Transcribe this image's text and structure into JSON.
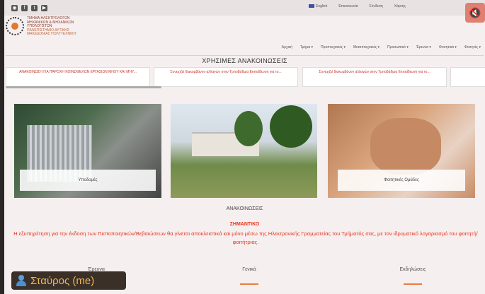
{
  "topbar": {
    "social_icons": [
      "rss-icon",
      "facebook-icon",
      "twitter-icon",
      "youtube-icon"
    ],
    "links": [
      "English",
      "Επικοινωνία",
      "Σύνδεση",
      "Χάρτης"
    ]
  },
  "header": {
    "logo_text_line1": "ΤΜΗΜΑ ΗΛΕΚΤΡΟΛΟΓΩΝ ΜΗΧΑΝΙΚΩΝ & ΜΗΧΑΝΙΚΩΝ ΥΠΟΛΟΓΙΣΤΩΝ",
    "logo_text_line2": "ΠΑΝΕΠΙΣΤΗΜΙΟ ΔΥΤΙΚΗΣ ΜΑΚΕΔΟΝΙΑΣ ΠΟΛΥΤΕΧΝΙΚΗ"
  },
  "nav": [
    "Αρχική",
    "Τμήμα ▾",
    "Προπτυχιακές ▾",
    "Μεταπτυχιακές ▾",
    "Προσωπικό ▾",
    "Έρευνα ▾",
    "Φοιτητικά ▾",
    "Φοιτητές ▾"
  ],
  "useful": {
    "title": "ΧΡΗΣΙΜΕΣ ΑΝΑΚΟΙΝΩΣΕΙΣ",
    "cards": [
      "ΑΝΑΚΟΙΝΩΣΗ ΓΙΑ ΠΑΡΟΧΗ ΚΟΙΝΩΦΕΛΩΝ ΕΡΓΑΣΙΩΝ ΜΗΧΥ ΚΑΙ ΜΗΥ...",
      "Συνεχιζεί διακυμβάνον αλλαγών στην Τριτοβάθμια Εκπαίδευση για το...",
      "Συνεχιζεί διακυμβάνον αλλαγών στην Τριτοβάθμια Εκπαίδευση για το...",
      ""
    ]
  },
  "features": [
    "Υποδομές",
    "",
    "Φοιτητικές Ομάδες"
  ],
  "news": {
    "title": "ΑΝΑΚΟΙΝΩΣΕΙΣ",
    "important": "ΣΗΜΑΝΤΙΚΟ",
    "notice": "Η εξυπηρέτηση για την έκδοση των Πιστοποιητικών/Βεβαιώσεων θα γίνεται αποκλειστικά και μόνο μέσω της Ηλεκτρονικής Γραμματείας του Τμήματός σας, με τον ιδρυματικό λογαριασμό του φοιτητή/ φοιτήτριας.",
    "tabs": [
      "Έρευνα",
      "Γενικά",
      "Εκδηλώσεις"
    ]
  },
  "overlay": {
    "user_name": "Σταύρος (me)",
    "muted_icon": "muted-mic-icon"
  },
  "colors": {
    "accent": "#e8341c",
    "tab_underline": "#e97d3d",
    "chip_text": "#f2b35a"
  }
}
